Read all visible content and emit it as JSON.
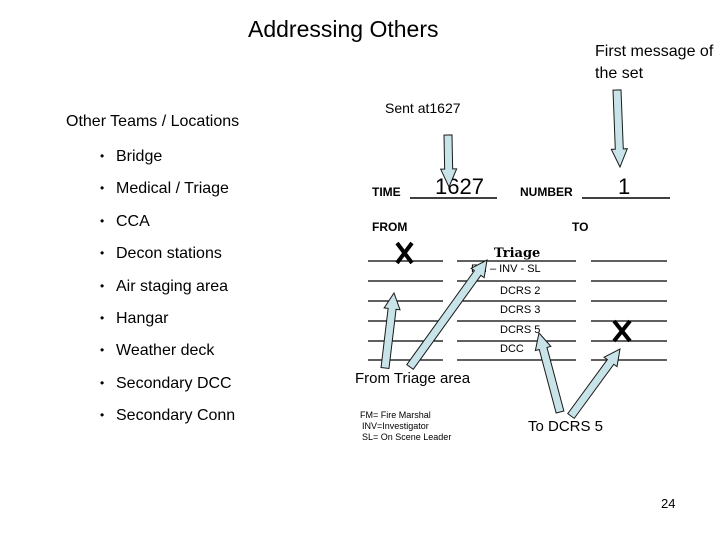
{
  "title": "Addressing Others",
  "first_message_note": "First message of the set",
  "sent_note": "Sent at1627",
  "teams": {
    "heading": "Other Teams / Locations",
    "items": [
      "Bridge",
      "Medical / Triage",
      "CCA",
      "Decon stations",
      "Air staging area",
      "Hangar",
      "Weather deck",
      "Secondary DCC",
      "Secondary Conn"
    ]
  },
  "form": {
    "time_label": "TIME",
    "time_value": "1627",
    "number_label": "NUMBER",
    "number_value": "1",
    "from_label": "FROM",
    "to_label": "TO",
    "middle_rows": [
      "Triage",
      "FM – INV - SL",
      "DCRS 2",
      "DCRS 3",
      "DCRS 5",
      "DCC"
    ]
  },
  "annotations": {
    "from_triage": "From Triage area",
    "to_dcrs5": "To DCRS 5",
    "legend": [
      "FM= Fire Marshal",
      "INV=Investigator",
      "SL= On Scene Leader"
    ]
  },
  "colors": {
    "arrow_fill": "#c8e4e8",
    "arrow_stroke": "#1a1a1a"
  },
  "page_number": "24"
}
